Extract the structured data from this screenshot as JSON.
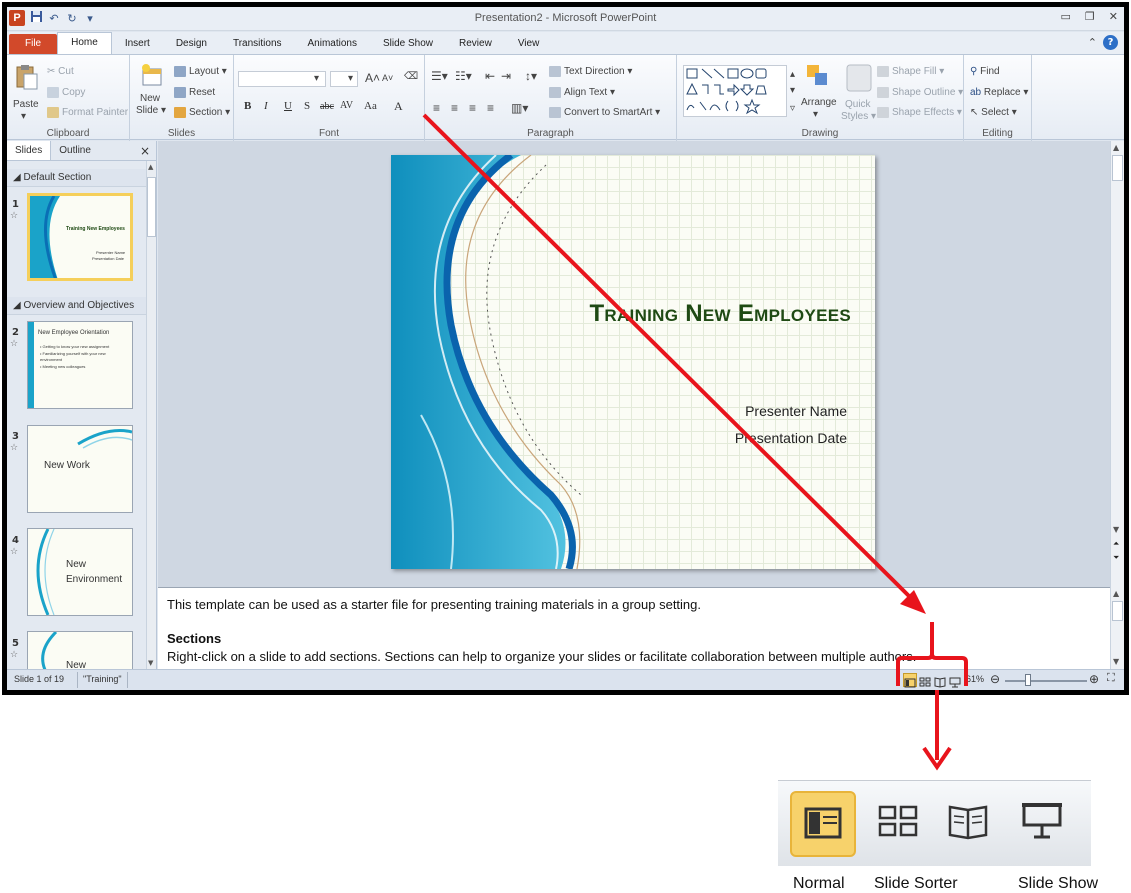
{
  "window": {
    "title": "Presentation2 - Microsoft PowerPoint",
    "logo_letter": "P"
  },
  "ribbon": {
    "tabs": [
      "File",
      "Home",
      "Insert",
      "Design",
      "Transitions",
      "Animations",
      "Slide Show",
      "Review",
      "View"
    ],
    "clipboard": {
      "paste": "Paste",
      "cut": "Cut",
      "copy": "Copy",
      "format_painter": "Format Painter",
      "label": "Clipboard"
    },
    "slides": {
      "new_slide_line1": "New",
      "new_slide_line2": "Slide",
      "layout": "Layout",
      "reset": "Reset",
      "section": "Section",
      "label": "Slides"
    },
    "font": {
      "label": "Font",
      "bold": "B",
      "italic": "I",
      "underline": "U",
      "strike": "S",
      "abc": "abc",
      "spacing": "AV",
      "case": "Aa",
      "color": "A"
    },
    "paragraph": {
      "text_direction": "Text Direction",
      "align_text": "Align Text",
      "convert_smartart": "Convert to SmartArt",
      "label": "Paragraph"
    },
    "drawing": {
      "arrange": "Arrange",
      "quick_styles_line1": "Quick",
      "quick_styles_line2": "Styles",
      "shape_fill": "Shape Fill",
      "shape_outline": "Shape Outline",
      "shape_effects": "Shape Effects",
      "label": "Drawing"
    },
    "editing": {
      "find": "Find",
      "replace": "Replace",
      "select": "Select",
      "label": "Editing"
    }
  },
  "slides_pane": {
    "tabs": [
      "Slides",
      "Outline"
    ],
    "close": "×",
    "sections": [
      "Default Section",
      "Overview and Objectives"
    ],
    "thumbnails": [
      {
        "num": "1",
        "title": "Training New Employees",
        "sub1": "Presenter Name",
        "sub2": "Presentation Date"
      },
      {
        "num": "2",
        "title": "New Employee Orientation",
        "bullets": [
          "Getting to know your new assignment",
          "Familiarizing yourself with your new environment",
          "Meeting new colleagues"
        ]
      },
      {
        "num": "3",
        "title": "New Work"
      },
      {
        "num": "4",
        "title_line1": "New",
        "title_line2": "Environment"
      },
      {
        "num": "5",
        "title": "New"
      }
    ]
  },
  "slide": {
    "title": "Training New Employees",
    "presenter": "Presenter Name",
    "date": "Presentation Date"
  },
  "notes": {
    "line1": "This template can be used as a starter file for presenting training materials in a group setting.",
    "heading": "Sections",
    "line2": "Right-click on a slide to add sections. Sections can help to organize your slides or facilitate collaboration between multiple authors."
  },
  "status": {
    "slide_info": "Slide 1 of 19",
    "theme": "\"Training\"",
    "zoom": "61%"
  },
  "zoomed_views": {
    "labels": [
      "Normal",
      "Slide Sorter",
      "Slide Show"
    ]
  },
  "colors": {
    "accent_red": "#e8141c",
    "file_tab": "#d2492a",
    "title_green": "#1f4a14",
    "normal_highlight": "#f7d26b"
  }
}
